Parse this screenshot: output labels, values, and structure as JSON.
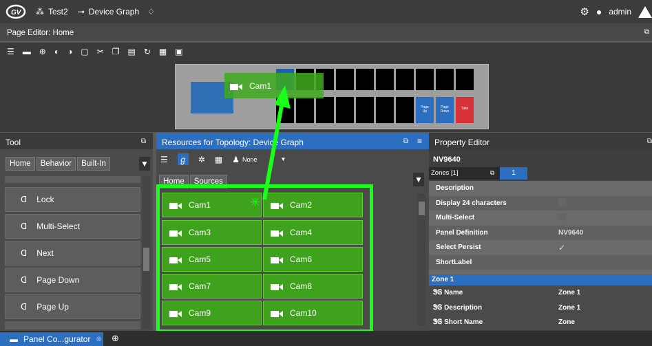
{
  "topbar": {
    "project": "Test2",
    "graph": "Device Graph",
    "user": "admin"
  },
  "page_editor": {
    "title": "Page Editor: Home",
    "drag_label": "Cam1"
  },
  "keys": {
    "page_up": "Page\nUp",
    "page_down": "Page\nDown",
    "take": "Take"
  },
  "tool": {
    "title": "Tool",
    "breadcrumbs": [
      "Home",
      "Behavior",
      "Built-In"
    ],
    "items": [
      "Lock",
      "Multi-Select",
      "Next",
      "Page Down",
      "Page Up"
    ]
  },
  "resources": {
    "title": "Resources for Topology: Device Graph",
    "filter": "None",
    "breadcrumbs": [
      "Home",
      "Sources"
    ],
    "cams": [
      "Cam1",
      "Cam2",
      "Cam3",
      "Cam4",
      "Cam5",
      "Cam6",
      "Cam7",
      "Cam8",
      "Cam9",
      "Cam10"
    ]
  },
  "property": {
    "title": "Property Editor",
    "device": "NV9640",
    "zones_label": "Zones [1]",
    "zone_tab": "1",
    "rows": [
      {
        "k": "Description",
        "v": ""
      },
      {
        "k": "Display 24 characters",
        "v": "checkbox"
      },
      {
        "k": "Multi-Select",
        "v": "checkbox"
      },
      {
        "k": "Panel Definition",
        "v": "NV9640"
      },
      {
        "k": "Select Persist",
        "v": "✓"
      },
      {
        "k": "ShortLabel",
        "v": ""
      }
    ],
    "zone_section": "Zone 1",
    "zone_rows": [
      {
        "k": "Name",
        "v": "Zone 1"
      },
      {
        "k": "Description",
        "v": "Zone 1"
      },
      {
        "k": "Short Name",
        "v": "Zone"
      }
    ]
  },
  "bottom": {
    "tab_label": "Panel Co...gurator"
  },
  "colors": {
    "accent": "#2c6fc0",
    "green": "#3ea21c",
    "highlight": "#19ff19",
    "red": "#d9333a"
  }
}
